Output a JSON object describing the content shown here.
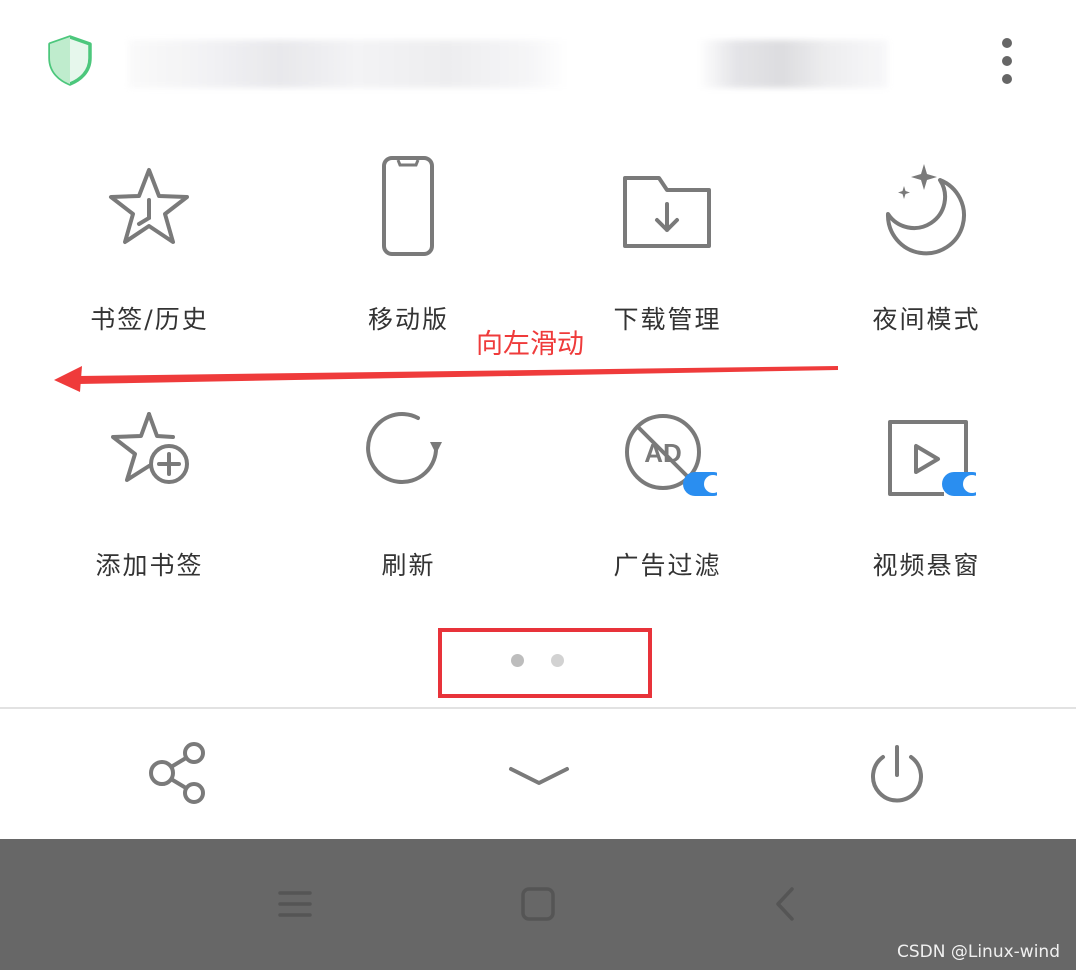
{
  "colors": {
    "icon_gray": "#7a7a7a",
    "shield_green": "#4cc77c",
    "toggle_blue": "#2a8ef0",
    "annotation_red": "#ef3b3b",
    "nav_bar_gray": "#676767"
  },
  "header": {
    "shield_icon": "shield-icon",
    "url_text": "",
    "more_icon": "more-vertical-icon"
  },
  "menu_grid": {
    "items": [
      {
        "label": "书签/历史",
        "icon": "bookmark-history-icon"
      },
      {
        "label": "移动版",
        "icon": "phone-icon"
      },
      {
        "label": "下载管理",
        "icon": "download-folder-icon"
      },
      {
        "label": "夜间模式",
        "icon": "night-mode-icon"
      },
      {
        "label": "添加书签",
        "icon": "add-bookmark-icon"
      },
      {
        "label": "刷新",
        "icon": "refresh-icon"
      },
      {
        "label": "广告过滤",
        "icon": "ad-filter-icon",
        "toggle": true
      },
      {
        "label": "视频悬窗",
        "icon": "video-float-icon",
        "toggle": true
      }
    ]
  },
  "annotation": {
    "text": "向左滑动"
  },
  "pager": {
    "pages": 2,
    "current": 1
  },
  "toolbar": {
    "items": [
      "share-icon",
      "collapse-chevron-icon",
      "power-icon"
    ]
  },
  "system_nav": {
    "items": [
      "menu-icon",
      "home-icon",
      "back-icon"
    ]
  },
  "watermark": "CSDN @Linux-wind"
}
